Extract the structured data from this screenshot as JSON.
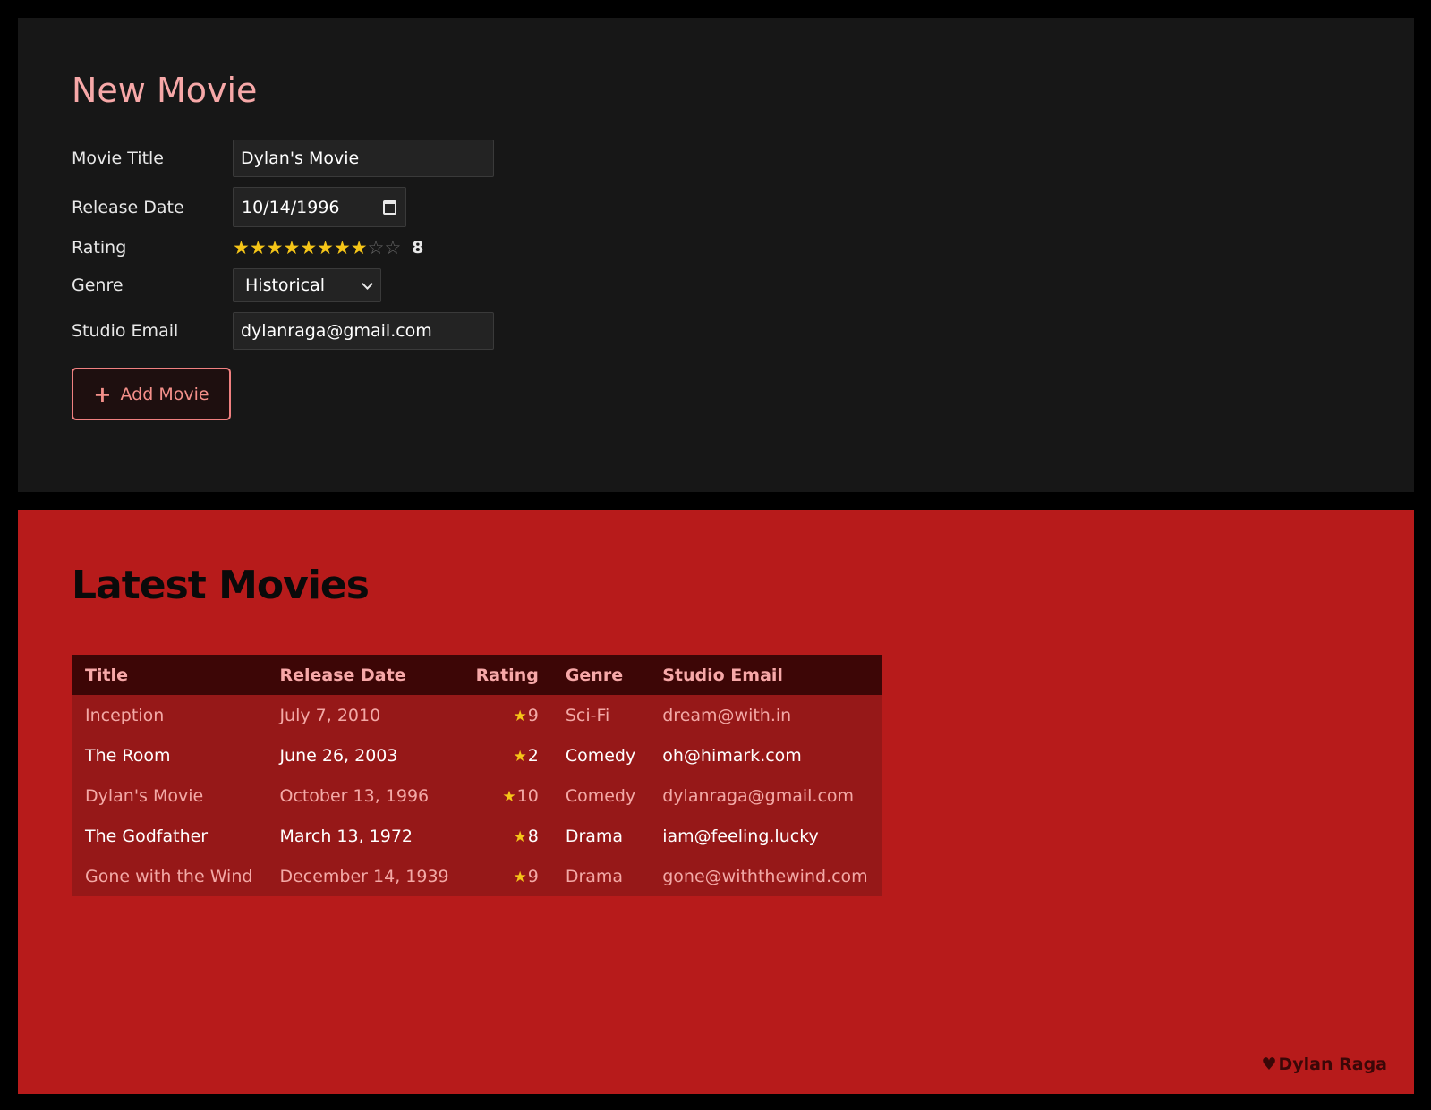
{
  "form": {
    "title": "New Movie",
    "fields": {
      "title_label": "Movie Title",
      "title_value": "Dylan's Movie",
      "date_label": "Release Date",
      "date_value": "10/14/1996",
      "rating_label": "Rating",
      "rating_value": "8",
      "rating_max": 10,
      "genre_label": "Genre",
      "genre_value": "Historical",
      "email_label": "Studio Email",
      "email_value": "dylanraga@gmail.com"
    },
    "submit_label": "Add Movie",
    "submit_icon": "plus-icon"
  },
  "list": {
    "title": "Latest Movies",
    "columns": {
      "title": "Title",
      "release_date": "Release Date",
      "rating": "Rating",
      "genre": "Genre",
      "email": "Studio Email"
    },
    "rows": [
      {
        "title": "Inception",
        "release_date": "July 7, 2010",
        "rating": "9",
        "genre": "Sci-Fi",
        "email": "dream@with.in"
      },
      {
        "title": "The Room",
        "release_date": "June 26, 2003",
        "rating": "2",
        "genre": "Comedy",
        "email": "oh@himark.com"
      },
      {
        "title": "Dylan's Movie",
        "release_date": "October 13, 1996",
        "rating": "10",
        "genre": "Comedy",
        "email": "dylanraga@gmail.com"
      },
      {
        "title": "The Godfather",
        "release_date": "March 13, 1972",
        "rating": "8",
        "genre": "Drama",
        "email": "iam@feeling.lucky"
      },
      {
        "title": "Gone with the Wind",
        "release_date": "December 14, 1939",
        "rating": "9",
        "genre": "Drama",
        "email": "gone@withthewind.com"
      }
    ]
  },
  "footer": {
    "author": "Dylan Raga",
    "icon": "heart-icon"
  },
  "colors": {
    "accent": "#f7a8a8",
    "star": "#f5c518",
    "panel_dark": "#171717",
    "panel_red": "#b71b1b"
  }
}
